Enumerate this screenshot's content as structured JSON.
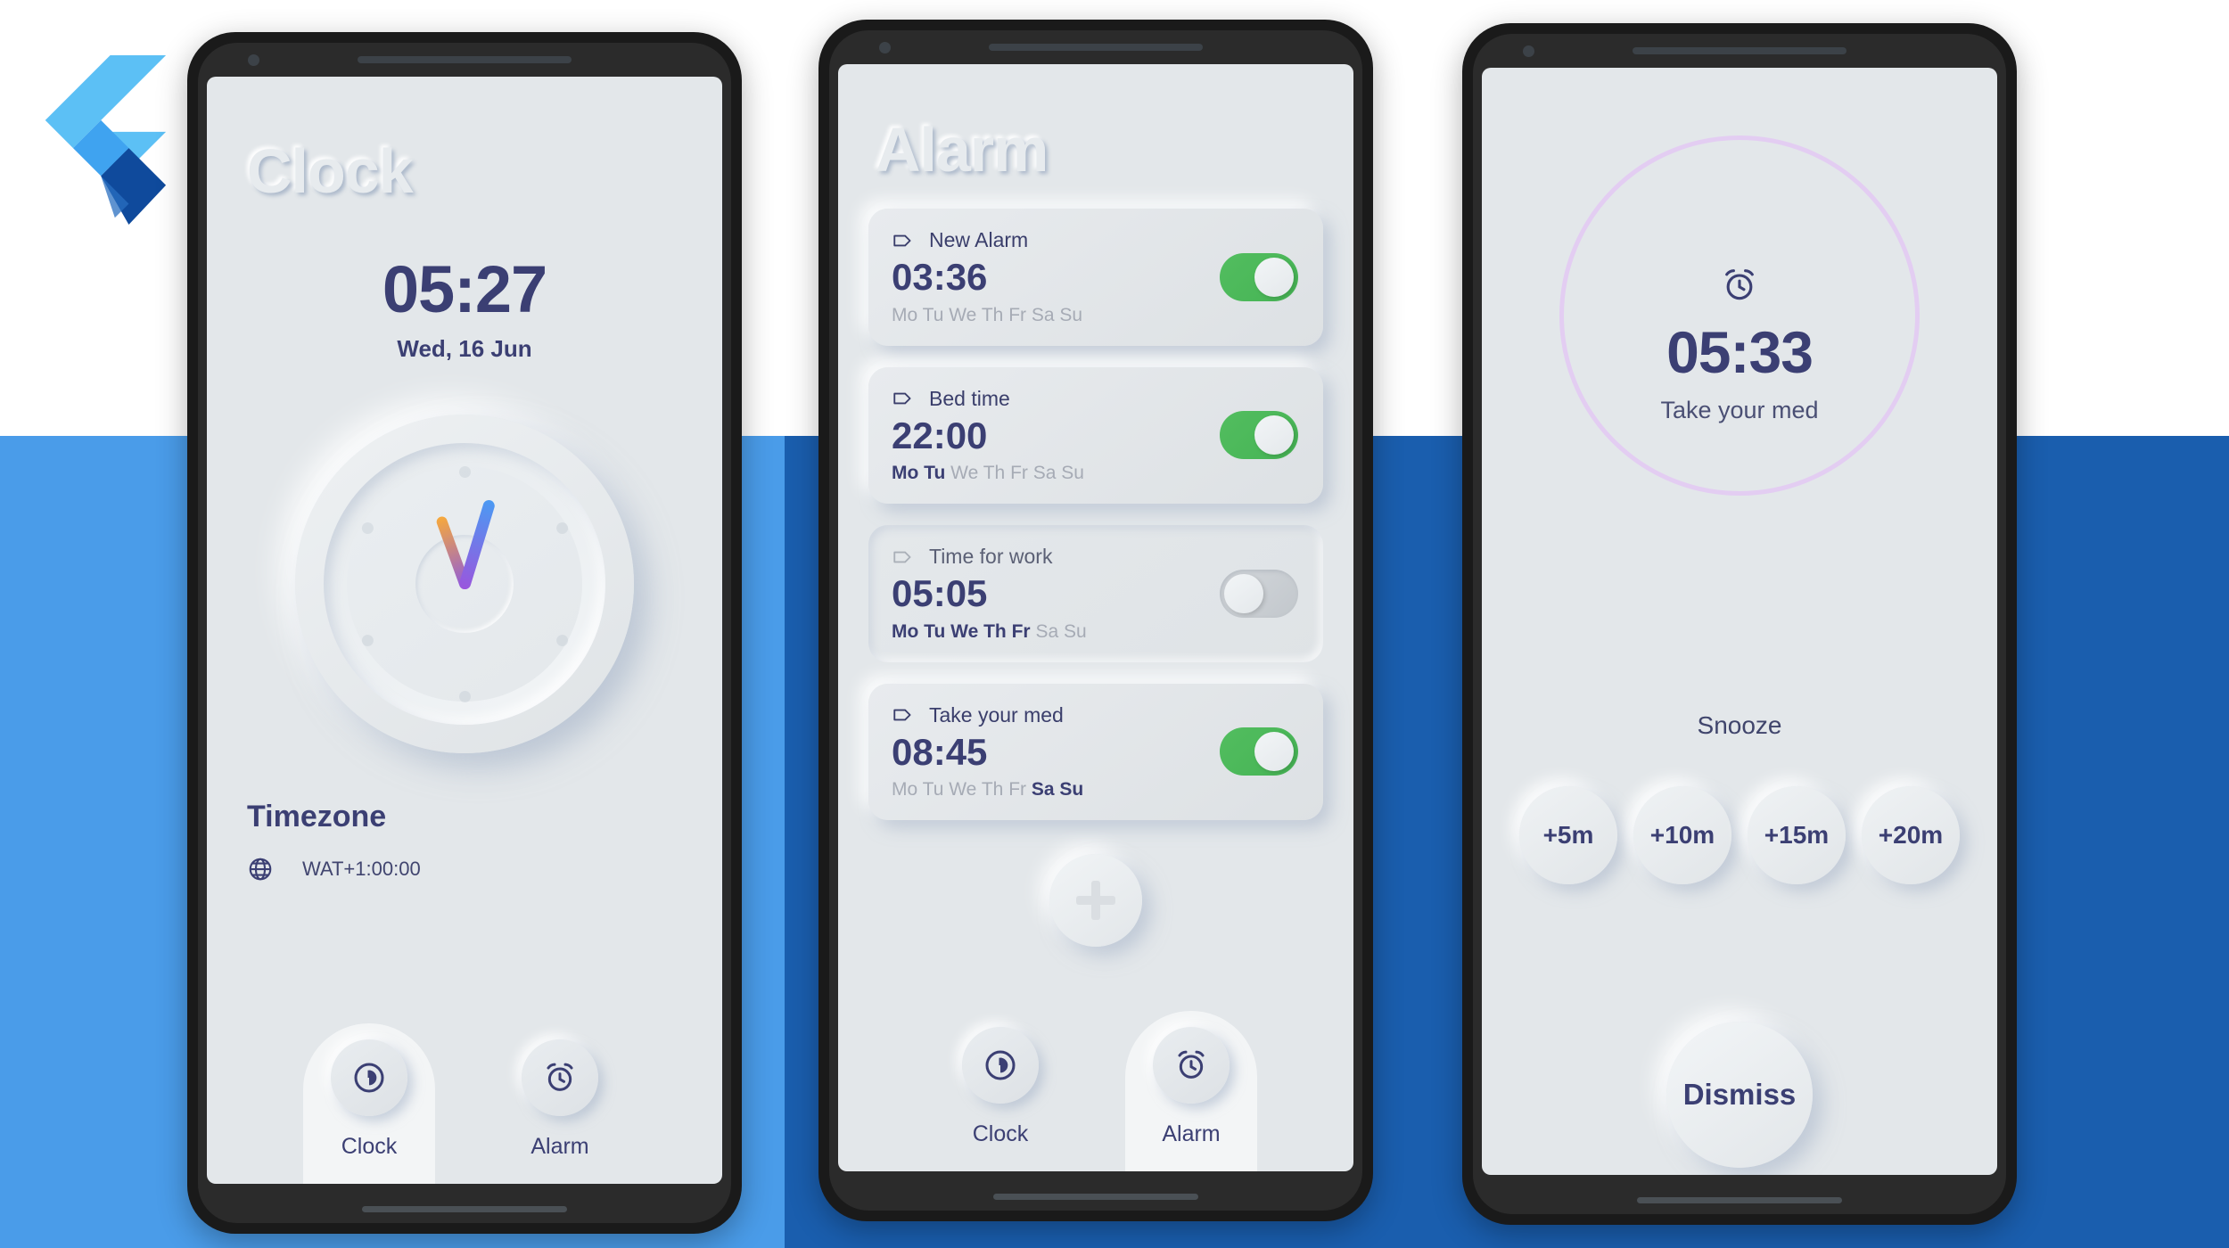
{
  "background": {
    "logo_name": "flutter-logo",
    "band_light_color": "#4a9ce9",
    "band_dark_color": "#1a5eae",
    "screen_bg_color": "#e3e7ea"
  },
  "theme": {
    "ink": "#3b3f73",
    "toggle_on_color": "#4db058",
    "toggle_off_color": "#c8ccd1",
    "ring_color": "#e3cdf2"
  },
  "clock_screen": {
    "title": "Clock",
    "time": "05:27",
    "date": "Wed, 16 Jun",
    "timezone_title": "Timezone",
    "timezone_value": "WAT+1:00:00",
    "timezone_icon": "globe-icon",
    "analog": {
      "hour_hand_angle_deg": 160,
      "minute_hand_angle_deg": 197
    },
    "nav": {
      "items": [
        {
          "label": "Clock",
          "icon": "clock-icon",
          "active": true
        },
        {
          "label": "Alarm",
          "icon": "alarm-icon",
          "active": false
        }
      ]
    }
  },
  "alarm_screen": {
    "title": "Alarm",
    "day_names": [
      "Mo",
      "Tu",
      "We",
      "Th",
      "Fr",
      "Sa",
      "Su"
    ],
    "add_button_icon": "plus-icon",
    "alarms": [
      {
        "label": "New Alarm",
        "time": "03:36",
        "days_on": [],
        "enabled": true,
        "icon": "tag-icon"
      },
      {
        "label": "Bed time",
        "time": "22:00",
        "days_on": [
          "Mo",
          "Tu"
        ],
        "enabled": true,
        "icon": "tag-icon"
      },
      {
        "label": "Time for work",
        "time": "05:05",
        "days_on": [
          "Mo",
          "Tu",
          "We",
          "Th",
          "Fr"
        ],
        "enabled": false,
        "icon": "tag-icon"
      },
      {
        "label": "Take your med",
        "time": "08:45",
        "days_on": [
          "Sa",
          "Su"
        ],
        "enabled": true,
        "icon": "tag-icon"
      }
    ],
    "nav": {
      "items": [
        {
          "label": "Clock",
          "icon": "clock-icon",
          "active": false
        },
        {
          "label": "Alarm",
          "icon": "alarm-icon",
          "active": true
        }
      ]
    }
  },
  "ringing_screen": {
    "icon": "alarm-icon",
    "time": "05:33",
    "label": "Take your med",
    "snooze_title": "Snooze",
    "snooze_options": [
      "+5m",
      "+10m",
      "+15m",
      "+20m"
    ],
    "dismiss_label": "Dismiss"
  }
}
